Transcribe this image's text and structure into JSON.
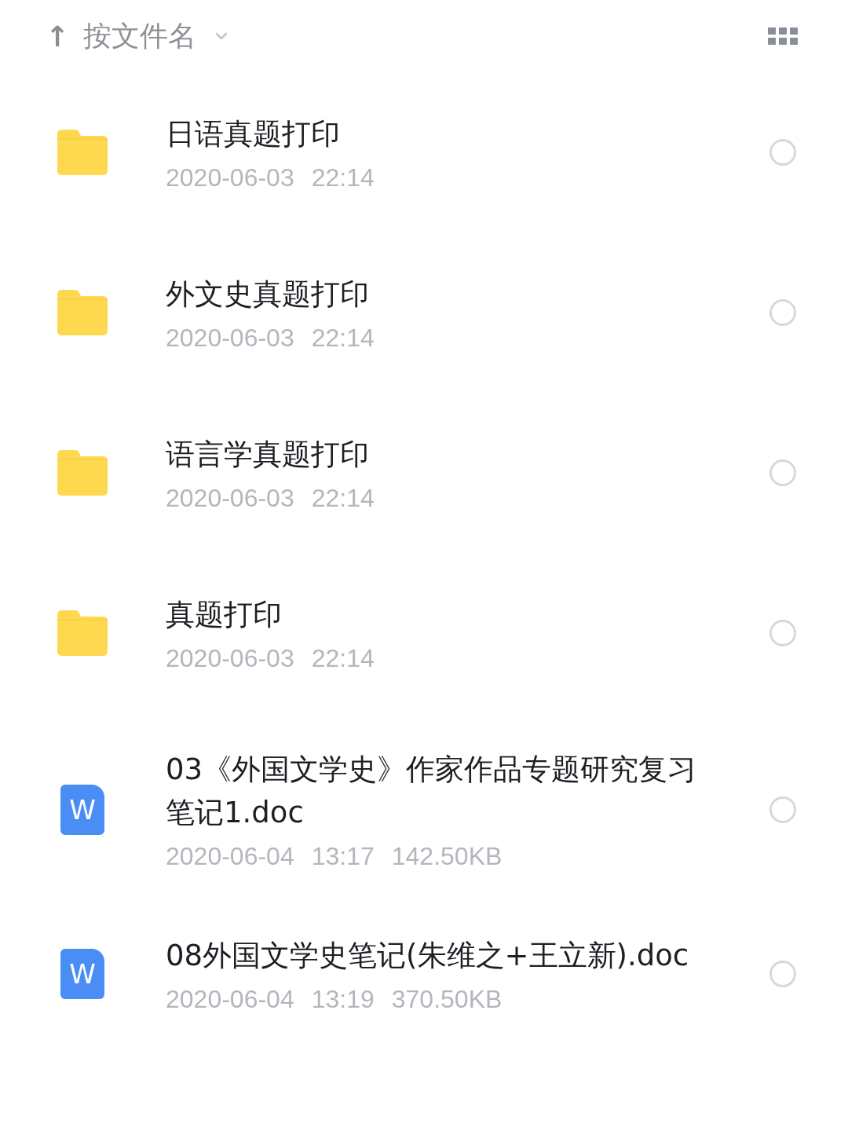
{
  "sort_bar": {
    "arrow": "↑",
    "label": "按文件名"
  },
  "files": [
    {
      "kind": "folder",
      "name": "日语真题打印",
      "meta": [
        "2020-06-03",
        "22:14"
      ],
      "selected": false
    },
    {
      "kind": "folder",
      "name": "外文史真题打印",
      "meta": [
        "2020-06-03",
        "22:14"
      ],
      "selected": false
    },
    {
      "kind": "folder",
      "name": "语言学真题打印",
      "meta": [
        "2020-06-03",
        "22:14"
      ],
      "selected": false
    },
    {
      "kind": "folder",
      "name": "真题打印",
      "meta": [
        "2020-06-03",
        "22:14"
      ],
      "selected": false
    },
    {
      "kind": "doc",
      "badge": "W",
      "name": "03《外国文学史》作家作品专题研究复习笔记1.doc",
      "meta": [
        "2020-06-04",
        "13:17",
        "142.50KB"
      ],
      "selected": false
    },
    {
      "kind": "doc",
      "badge": "W",
      "name": "08外国文学史笔记(朱维之+王立新).doc",
      "meta": [
        "2020-06-04",
        "13:19",
        "370.50KB"
      ],
      "selected": false
    }
  ]
}
